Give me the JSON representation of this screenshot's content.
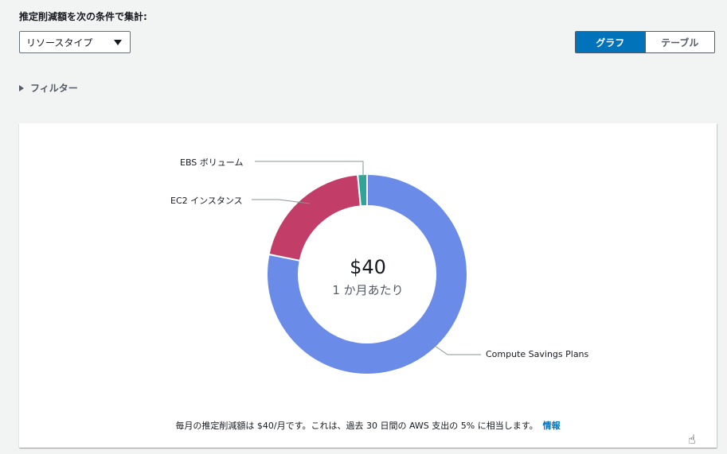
{
  "header": {
    "title": "推定削減額を次の条件で集計:",
    "groupby_selected": "リソースタイプ"
  },
  "view_toggle": {
    "graph_label": "グラフ",
    "table_label": "テーブル",
    "active": "graph"
  },
  "filter": {
    "label": "フィルター"
  },
  "chart_data": {
    "type": "pie",
    "donut": true,
    "center_value": "$40",
    "center_subtitle": "1 か月あたり",
    "slices": [
      {
        "name": "Compute Savings Plans",
        "value": 0.782,
        "color": "#6a8ce8"
      },
      {
        "name": "EC2 インスタンス",
        "value": 0.203,
        "color": "#c33d69"
      },
      {
        "name": "EBS ボリューム",
        "value": 0.015,
        "color": "#2ea597"
      }
    ]
  },
  "footer": {
    "summary": "毎月の推定削減額は $40/月です。これは、過去 30 日間の AWS 支出の 5% に相当します。",
    "info_link": "情報"
  },
  "colors": {
    "accent": "#0073bb",
    "background": "#f2f3f3"
  },
  "icons": {
    "select_caret": "caret-down-icon",
    "filter_expand": "caret-right-icon",
    "cursor": "hand-pointer-icon"
  }
}
